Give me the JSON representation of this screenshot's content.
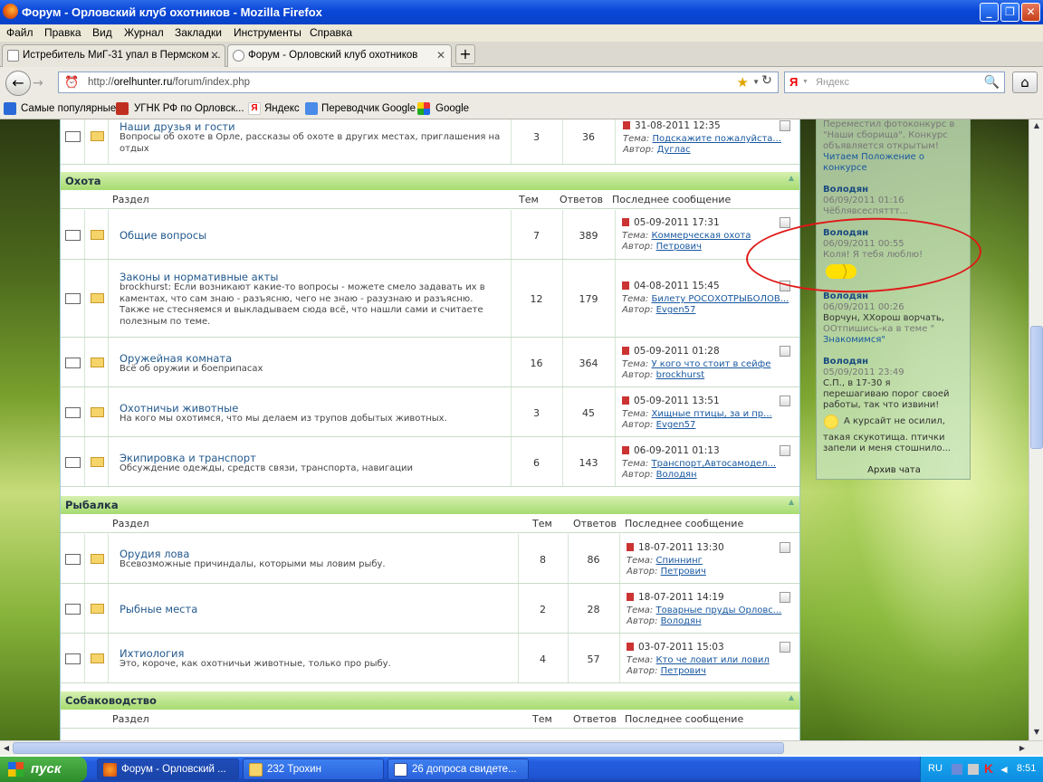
{
  "window": {
    "title": "Форум - Орловский клуб охотников - Mozilla Firefox"
  },
  "menu": [
    "Файл",
    "Правка",
    "Вид",
    "Журнал",
    "Закладки",
    "Инструменты",
    "Справка"
  ],
  "tabs": [
    {
      "label": "Истребитель МиГ-31 упал в Пермском ..."
    },
    {
      "label": "Форум - Орловский клуб охотников"
    }
  ],
  "url": {
    "prefix": "http://",
    "host": "orelhunter.ru",
    "path": "/forum/index.php"
  },
  "search": {
    "placeholder": "Яндекс"
  },
  "bookmarks": [
    "Самые популярные",
    "УГНК РФ по Орловск...",
    "Яндекс",
    "Переводчик Google",
    "Google"
  ],
  "forum": {
    "col_headers": {
      "section": "Раздел",
      "topics": "Тем",
      "replies": "Ответов",
      "last": "Последнее сообщение"
    },
    "topic_label": "Тема:",
    "author_label": "Автор:",
    "top_row": {
      "name": "Наши друзья и гости",
      "desc": "Вопросы об охоте в Орле, рассказы об охоте в других местах, приглашения на отдых",
      "topics": "3",
      "replies": "36",
      "date": "31-08-2011 12:35",
      "topic": "Подскажите пожалуйста...",
      "author": "Дуглас"
    },
    "categories": [
      {
        "title": "Охота",
        "rows": [
          {
            "name": "Общие вопросы",
            "desc": "",
            "topics": "7",
            "replies": "389",
            "date": "05-09-2011 17:31",
            "topic": "Коммерческая охота",
            "author": "Петрович"
          },
          {
            "name": "Законы и нормативные акты",
            "desc": "brockhurst: Если возникают какие-то вопросы - можете смело задавать их в каментах, что сам знаю - разъясню, чего не знаю - разузнаю и разъясню. Также не стесняемся и выкладываем сюда всё, что нашли сами и считаете полезным по теме.",
            "topics": "12",
            "replies": "179",
            "date": "04-08-2011 15:45",
            "topic": "Билету РОСОХОТРЫБОЛОВ...",
            "author": "Evgen57"
          },
          {
            "name": "Оружейная комната",
            "desc": "Всё об оружии и боеприпасах",
            "topics": "16",
            "replies": "364",
            "date": "05-09-2011 01:28",
            "topic": "У кого что стоит в сейфе",
            "author": "brockhurst"
          },
          {
            "name": "Охотничьи животные",
            "desc": "На кого мы охотимся, что мы делаем из трупов добытых животных.",
            "topics": "3",
            "replies": "45",
            "date": "05-09-2011 13:51",
            "topic": "Хищные птицы, за и пр...",
            "author": "Evgen57"
          },
          {
            "name": "Экипировка и транспорт",
            "desc": "Обсуждение одежды, средств связи, транспорта, навигации",
            "topics": "6",
            "replies": "143",
            "date": "06-09-2011 01:13",
            "topic": "Транспорт,Автосамодел...",
            "author": "Володян"
          }
        ]
      },
      {
        "title": "Рыбалка",
        "rows": [
          {
            "name": "Орудия лова",
            "desc": "Всевозможные причиндалы, которыми мы ловим рыбу.",
            "topics": "8",
            "replies": "86",
            "date": "18-07-2011 13:30",
            "topic": "Спиннинг",
            "author": "Петрович"
          },
          {
            "name": "Рыбные места",
            "desc": "",
            "topics": "2",
            "replies": "28",
            "date": "18-07-2011 14:19",
            "topic": "Товарные пруды Орловс...",
            "author": "Володян"
          },
          {
            "name": "Ихтиология",
            "desc": "Это, короче, как охотничьи животные, только про рыбу.",
            "topics": "4",
            "replies": "57",
            "date": "03-07-2011 15:03",
            "topic": "Кто че ловит или ловил",
            "author": "Петрович"
          }
        ]
      },
      {
        "title": "Собаководство",
        "rows": []
      }
    ]
  },
  "chat": {
    "lines": [
      {
        "text": "Переместил фотоконкурс в",
        "style": "g"
      },
      {
        "text": "\"Наши сборища\". Конкурс",
        "style": "g"
      },
      {
        "text": "объявляется открытым!",
        "style": "g"
      },
      {
        "text": "Читаем Положение о",
        "style": "l"
      },
      {
        "text": "конкурсе",
        "style": "l"
      },
      {
        "text": "Володян",
        "style": "b"
      },
      {
        "text": "06/09/2011 01:16",
        "style": "g"
      },
      {
        "text": "Чёблявсеспяттт...",
        "style": "g"
      },
      {
        "text": "Володян",
        "style": "b"
      },
      {
        "text": "06/09/2011 00:55",
        "style": "g"
      },
      {
        "text": "Коля! Я тебя люблю!",
        "style": "g"
      },
      {
        "text": "Володян",
        "style": "b"
      },
      {
        "text": "06/09/2011 00:26",
        "style": "g"
      },
      {
        "text": "Ворчун, ХХорош ворчать,",
        "style": ""
      },
      {
        "text": "ООтпишись-ка в теме \"",
        "style": "g"
      },
      {
        "text": "Знакомимся\"",
        "style": "l"
      },
      {
        "text": "Володян",
        "style": "b"
      },
      {
        "text": "05/09/2011 23:49",
        "style": "g"
      },
      {
        "text": "С.П., в 17-30 я",
        "style": ""
      },
      {
        "text": "перешагиваю порог своей",
        "style": ""
      },
      {
        "text": "работы, так что извини!",
        "style": ""
      },
      {
        "text": "А курсайт не осилил,",
        "style": ""
      },
      {
        "text": "такая скукотища. птички",
        "style": ""
      },
      {
        "text": "запели и меня стошнило...",
        "style": ""
      }
    ],
    "archive": "Архив чата"
  },
  "taskbar": {
    "start": "пуск",
    "items": [
      "Форум - Орловский ...",
      "232 Трохин",
      "26 допроса свидете..."
    ],
    "lang": "RU",
    "time": "8:51"
  }
}
